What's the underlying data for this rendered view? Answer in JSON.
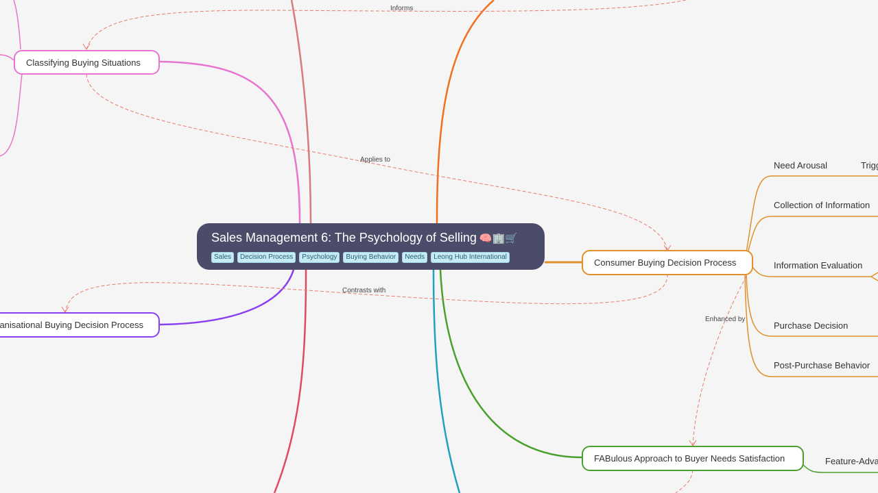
{
  "root": {
    "title": "Sales Management 6: The Psychology of Selling",
    "emoji": "🧠🏢🛒",
    "tags": [
      "Sales",
      "Decision Process",
      "Psychology",
      "Buying Behavior",
      "Needs",
      "Leong Hub International"
    ]
  },
  "branches": {
    "classifying": {
      "label": "Classifying Buying Situations",
      "color": "#e874d0"
    },
    "organisational": {
      "label": "Organisational Buying Decision Process",
      "visible_label": "anisational Buying Decision Process",
      "color": "#8a3ff0"
    },
    "consumer": {
      "label": "Consumer Buying Decision Process",
      "color": "#e0902a"
    },
    "fabulous": {
      "label": "FABulous Approach to Buyer Needs Satisfaction",
      "color": "#4aa02c"
    },
    "top_center": {
      "color": "#d97a7a"
    },
    "top_right": {
      "color": "#f07020"
    },
    "bottom_left": {
      "color": "#e04a5e"
    },
    "bottom_center": {
      "color": "#20a0c0"
    }
  },
  "consumer_children": [
    {
      "label": "Need Arousal"
    },
    {
      "label": "Collection of Information"
    },
    {
      "label": "Information Evaluation"
    },
    {
      "label": "Purchase Decision"
    },
    {
      "label": "Post-Purchase Behavior"
    }
  ],
  "consumer_grandchild": {
    "label": "Trigg"
  },
  "fabulous_children": [
    {
      "label": "Feature-Adva"
    }
  ],
  "relations": [
    {
      "label": "Informs",
      "color": "#e87a6a"
    },
    {
      "label": "Applies to",
      "color": "#e87a6a"
    },
    {
      "label": "Contrasts with",
      "color": "#e87a6a"
    },
    {
      "label": "Enhanced by",
      "color": "#e87a6a"
    }
  ]
}
